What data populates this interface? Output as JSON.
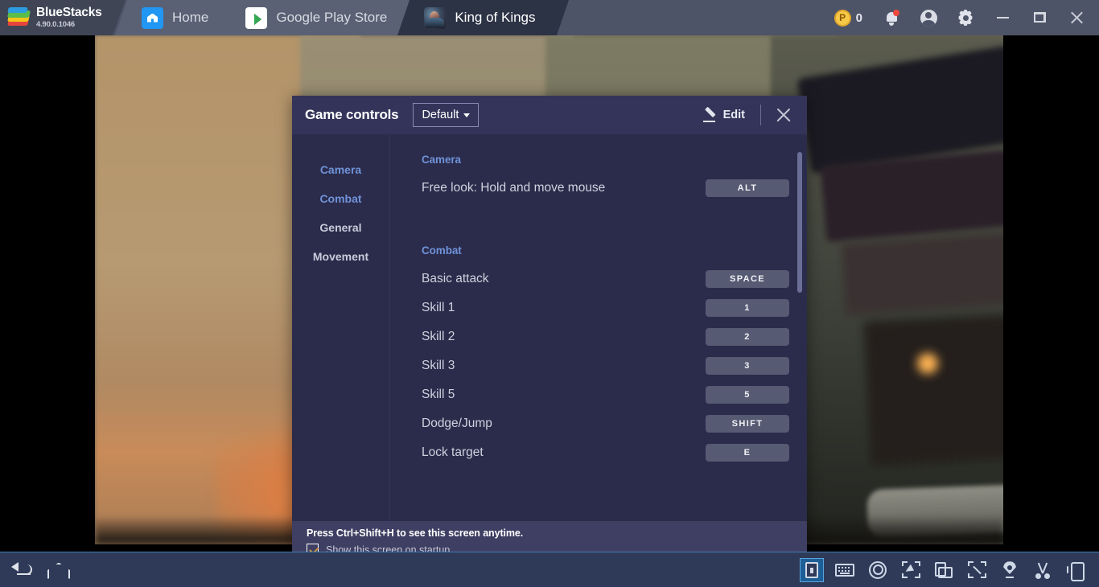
{
  "titlebar": {
    "brand_name": "BlueStacks",
    "version": "4.90.0.1046",
    "tabs": [
      {
        "label": "Home",
        "icon": "home-icon",
        "active": false
      },
      {
        "label": "Google Play Store",
        "icon": "google-play-icon",
        "active": false
      },
      {
        "label": "King of Kings",
        "icon": "king-of-kings-app-icon",
        "active": true
      }
    ],
    "points_value": "0",
    "points_icon": "points-coin-icon",
    "notification_icon": "bell-icon",
    "account_icon": "account-avatar-icon",
    "settings_icon": "gear-icon",
    "minimize_icon": "minimize-icon",
    "maximize_icon": "maximize-icon",
    "close_icon": "close-icon"
  },
  "dialog": {
    "title": "Game controls",
    "profile": "Default",
    "edit_label": "Edit",
    "edit_icon": "pencil-icon",
    "close_icon": "close-icon",
    "nav": [
      {
        "label": "Camera",
        "highlighted": true
      },
      {
        "label": "Combat",
        "highlighted": true
      },
      {
        "label": "General",
        "highlighted": false
      },
      {
        "label": "Movement",
        "highlighted": false
      }
    ],
    "sections": [
      {
        "title": "Camera",
        "bindings": [
          {
            "action": "Free look: Hold and move mouse",
            "key": "ALT"
          }
        ]
      },
      {
        "title": "Combat",
        "bindings": [
          {
            "action": "Basic attack",
            "key": "SPACE"
          },
          {
            "action": "Skill 1",
            "key": "1"
          },
          {
            "action": "Skill 2",
            "key": "2"
          },
          {
            "action": "Skill 3",
            "key": "3"
          },
          {
            "action": "Skill 5",
            "key": "5"
          },
          {
            "action": "Dodge/Jump",
            "key": "SHIFT"
          },
          {
            "action": "Lock target",
            "key": "E"
          }
        ]
      }
    ],
    "footer": {
      "hint": "Press Ctrl+Shift+H to see this screen anytime.",
      "checkbox_label": "Show this screen on startup",
      "checkbox_checked": true
    }
  },
  "bottombar": {
    "left": [
      {
        "name": "back-icon"
      },
      {
        "name": "home-icon"
      }
    ],
    "right": [
      {
        "name": "game-controls-icon",
        "selected": true
      },
      {
        "name": "keyboard-icon",
        "selected": false
      },
      {
        "name": "macro-recorder-icon",
        "selected": false
      },
      {
        "name": "multi-select-cursor-icon",
        "selected": false
      },
      {
        "name": "rotate-screen-icon",
        "selected": false
      },
      {
        "name": "fullscreen-icon",
        "selected": false
      },
      {
        "name": "location-pin-icon",
        "selected": false
      },
      {
        "name": "scissors-screenshot-icon",
        "selected": false
      },
      {
        "name": "shake-device-icon",
        "selected": false
      }
    ]
  },
  "colors": {
    "titlebar_bg": "#4d5467",
    "active_tab_bg": "#2c3345",
    "dialog_bg": "#2b2b4b",
    "dialog_header_bg": "#34345a",
    "dialog_footer_bg": "#3f3f63",
    "accent_link": "#6f93d8",
    "keycap_bg": "#565a72",
    "bottombar_bg": "#2f3a59",
    "selected_tool_bg": "#1e5e96",
    "notification_dot": "#f0483e"
  }
}
